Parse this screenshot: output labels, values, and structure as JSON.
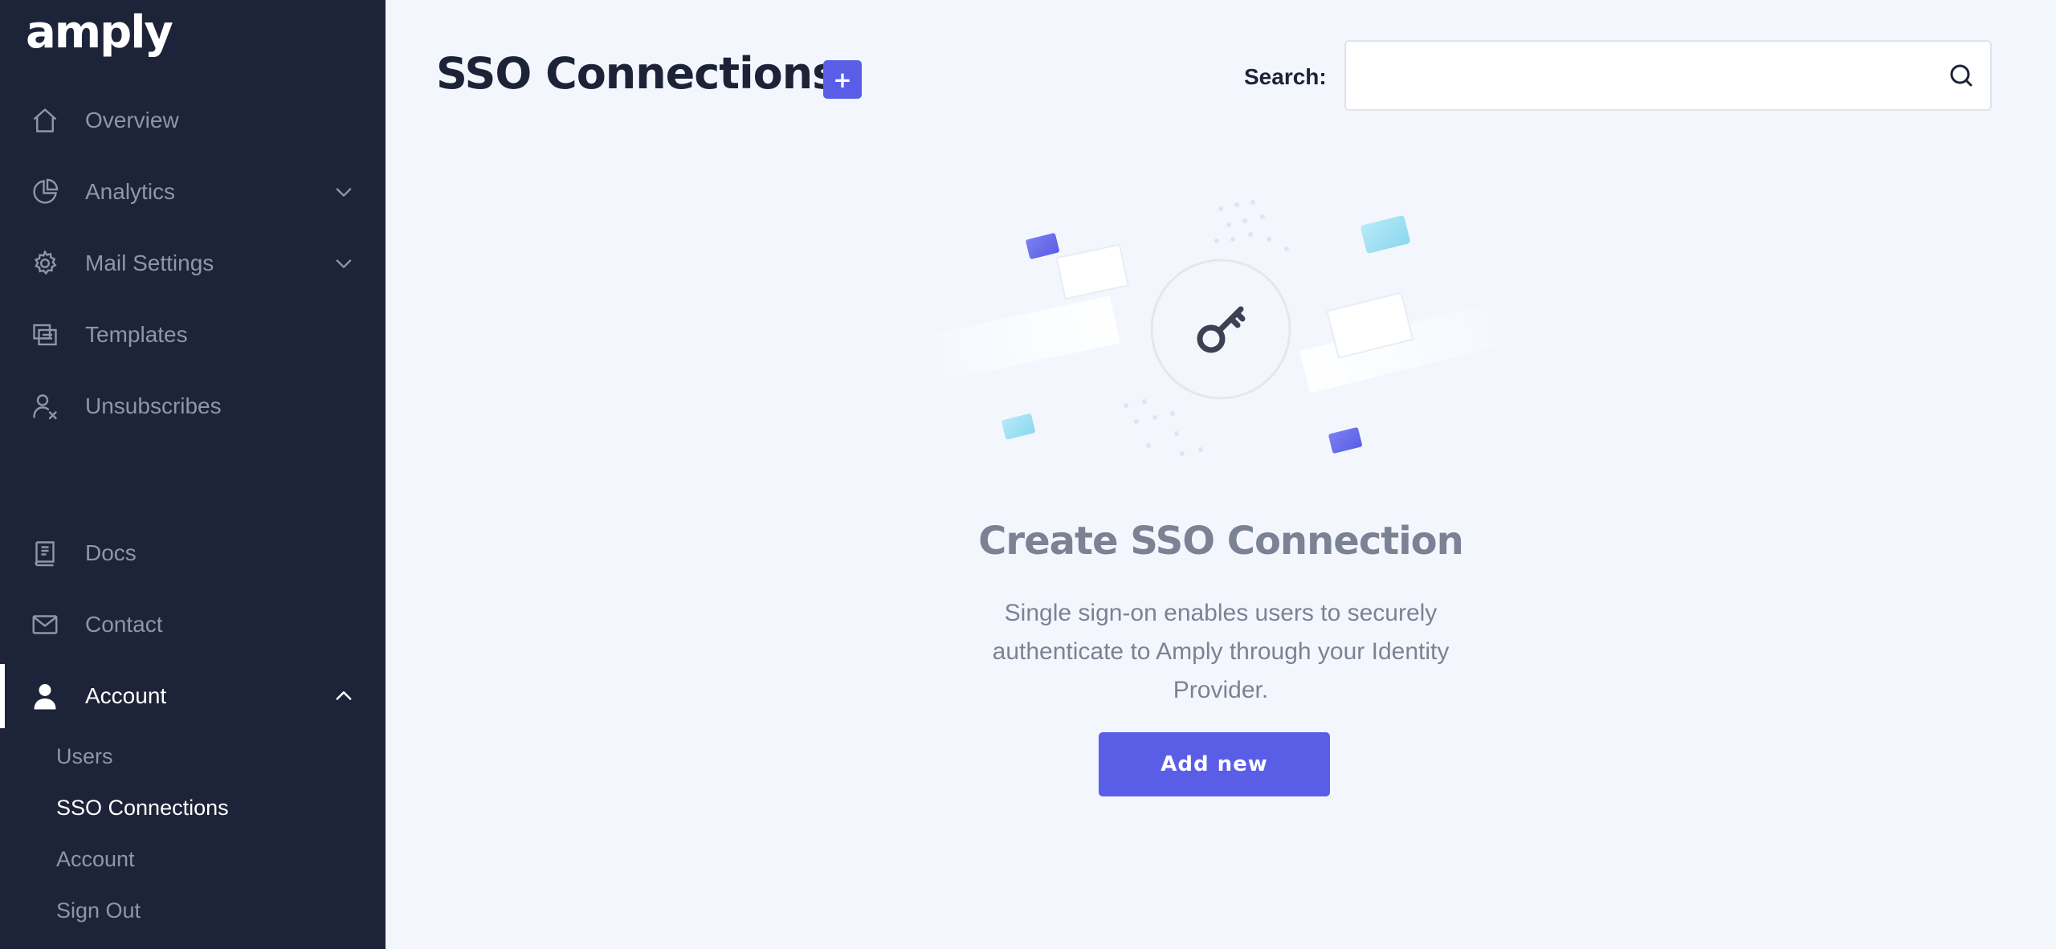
{
  "brand": {
    "logo_text": "amply"
  },
  "sidebar": {
    "items": [
      {
        "label": "Overview",
        "icon": "home-icon"
      },
      {
        "label": "Analytics",
        "icon": "pie-chart-icon",
        "expandable": true
      },
      {
        "label": "Mail Settings",
        "icon": "gear-icon",
        "expandable": true
      },
      {
        "label": "Templates",
        "icon": "templates-icon"
      },
      {
        "label": "Unsubscribes",
        "icon": "user-x-icon"
      },
      {
        "label": "Docs",
        "icon": "book-icon"
      },
      {
        "label": "Contact",
        "icon": "mail-icon"
      },
      {
        "label": "Account",
        "icon": "user-icon",
        "expanded": true,
        "active": true
      }
    ],
    "account_subitems": [
      {
        "label": "Users"
      },
      {
        "label": "SSO Connections",
        "current": true
      },
      {
        "label": "Account"
      },
      {
        "label": "Sign Out"
      }
    ]
  },
  "header": {
    "title": "SSO Connections",
    "add_button_label": "+",
    "search_label": "Search:",
    "search_value": "",
    "search_placeholder": ""
  },
  "empty_state": {
    "title": "Create SSO Connection",
    "description": "Single sign-on enables users to securely authenticate to Amply through your Identity Provider.",
    "button_label": "Add new",
    "illustration_icon": "key-icon"
  },
  "colors": {
    "sidebar_bg": "#1d2338",
    "main_bg": "#f3f7fd",
    "accent": "#5a5ee6",
    "text_dark": "#1c2337",
    "text_muted": "#7b8294"
  }
}
